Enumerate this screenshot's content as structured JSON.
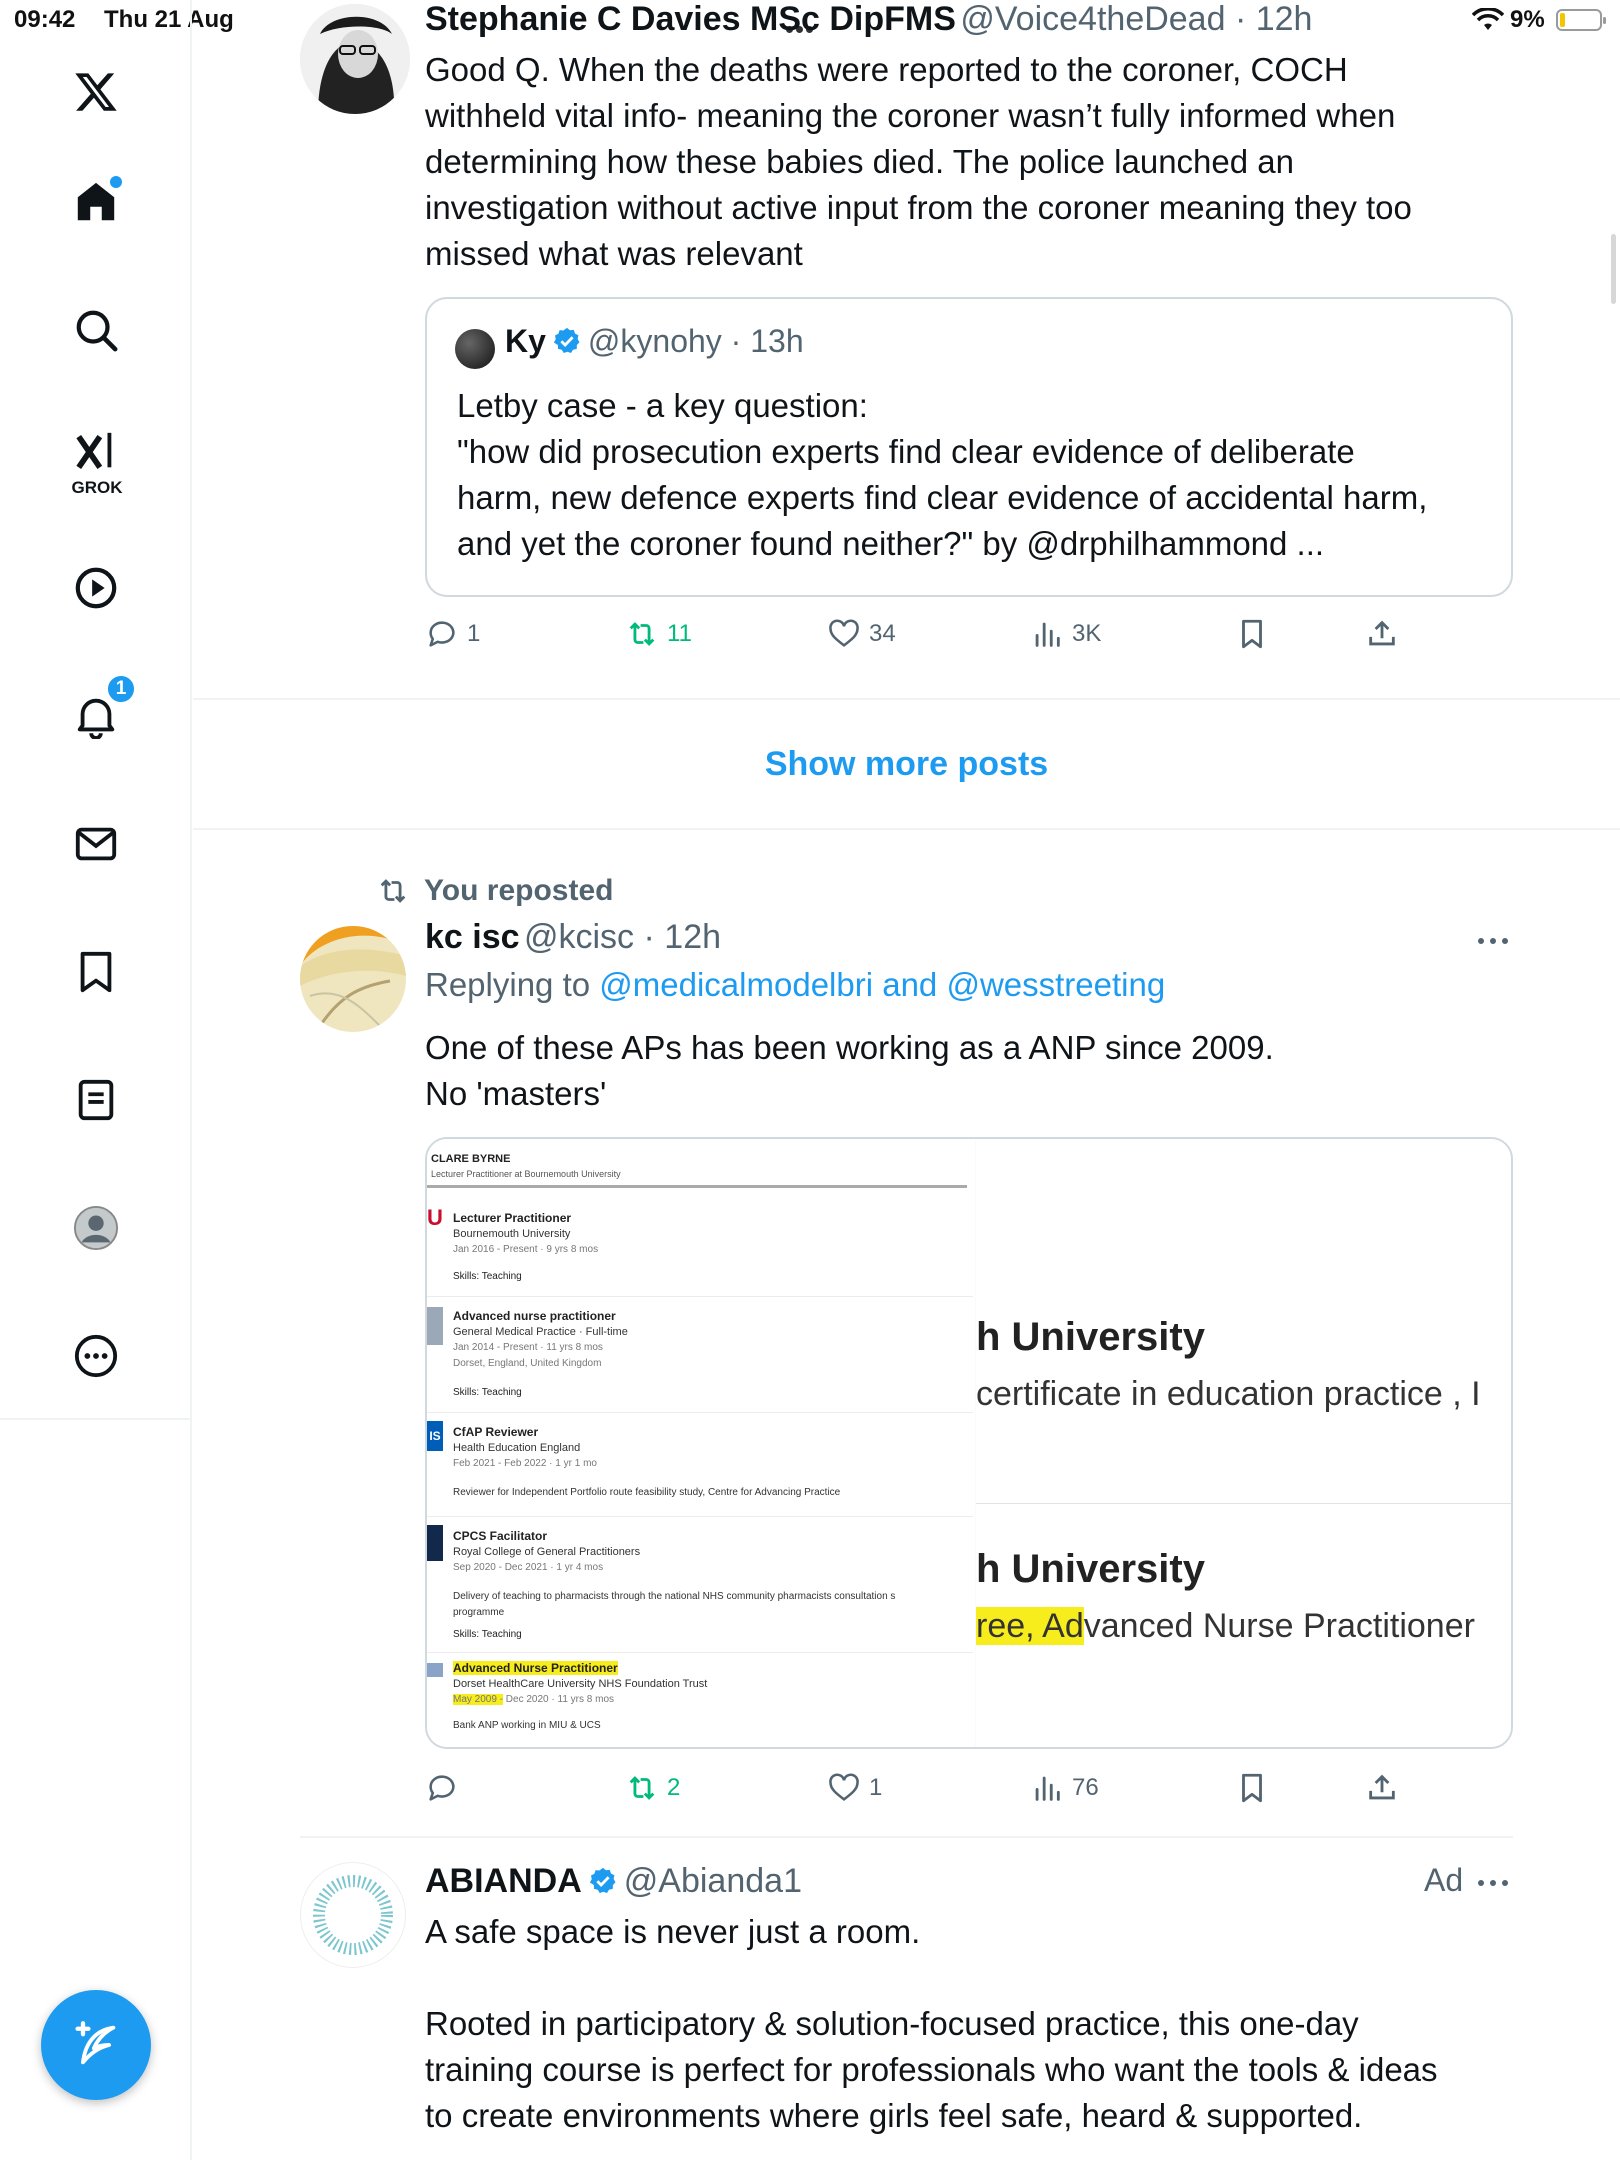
{
  "status_bar": {
    "time": "09:42",
    "date": "Thu 21 Aug",
    "battery": "9%"
  },
  "sidebar": {
    "grok_label": "GROK",
    "notifications_badge": "1"
  },
  "post1": {
    "name": "Stephanie C Davies MSc DipFMS",
    "handle": "@Voice4theDead",
    "time": "12h",
    "lines": [
      "Good Q.  When the deaths were reported to the coroner, COCH",
      "withheld vital info- meaning the coroner wasn’t fully informed when",
      "determining how these babies died. The police launched an",
      "investigation without active input from the coroner meaning they too",
      "missed what was relevant"
    ],
    "quote": {
      "name": "Ky",
      "handle": "@kynohy",
      "time": "13h",
      "lines": [
        "Letby case - a key question:",
        "\"how did prosecution experts find clear evidence of deliberate",
        "harm, new defence experts find clear evidence of accidental harm,",
        "and yet the coroner found neither?\" by @drphilhammond  ..."
      ]
    },
    "actions": {
      "replies": "1",
      "reposts": "11",
      "likes": "34",
      "views": "3K"
    }
  },
  "show_more": "Show more posts",
  "post2": {
    "repost_label": "You reposted",
    "name": "kc isc",
    "handle": "@kcisc",
    "time": "12h",
    "replying_prefix": "Replying to",
    "replying_to": "@medicalmodelbri and @wesstreeting",
    "lines": [
      "One of these APs has been working as a ANP since 2009.",
      "No 'masters'"
    ],
    "actions": {
      "reposts": "2",
      "likes": "1",
      "views": "76"
    },
    "image": {
      "profile_name": "CLARE BYRNE",
      "profile_headline": "Lecturer Practitioner at Bournemouth University",
      "entries": [
        {
          "title": "Lecturer Practitioner",
          "org": "Bournemouth University",
          "dates": "Jan 2016 - Present · 9 yrs 8 mos",
          "extra": "",
          "skills": "Skills: Teaching"
        },
        {
          "title": "Advanced nurse practitioner",
          "org": "General Medical Practice · Full-time",
          "dates": "Jan 2014 - Present · 11 yrs 8 mos",
          "extra": "Dorset, England, United Kingdom",
          "skills": "Skills: Teaching"
        },
        {
          "title": "CfAP Reviewer",
          "org": "Health Education England",
          "dates": "Feb 2021 - Feb 2022 · 1 yr 1 mo",
          "extra": "Reviewer for Independent Portfolio route feasibility study, Centre for Advancing Practice",
          "skills": ""
        },
        {
          "title": "CPCS Facilitator",
          "org": "Royal College of General Practitioners",
          "dates": "Sep 2020 - Dec 2021 · 1 yr 4 mos",
          "extra": "Delivery of teaching to pharmacists through the national NHS community pharmacists consultation s",
          "extra2": "programme",
          "skills": "Skills: Teaching"
        },
        {
          "title": "Advanced Nurse Practitioner",
          "org": "Dorset HealthCare University NHS Foundation Trust",
          "dates_hl": "May 2009 -",
          "dates": " Dec 2020 · 11 yrs 8 mos",
          "extra": "Bank ANP working in MIU & UCS",
          "skills": ""
        }
      ],
      "right": {
        "uni1": "h University",
        "sub1": "certificate in education practice , I",
        "uni2": "h University",
        "sub2_hl": "ree, Ad",
        "sub2": "vanced Nurse Practitioner"
      }
    }
  },
  "post3": {
    "name": "ABIANDA",
    "handle": "@Abianda1",
    "ad_label": "Ad",
    "line1": "A safe space is never just a room.",
    "lines": [
      "Rooted in participatory & solution-focused practice, this one-day",
      "training course is perfect for professionals who want the tools & ideas",
      "to create environments where girls feel safe, heard & supported."
    ]
  },
  "colors": {
    "accent": "#1d9bf0",
    "repost_green": "#00ba7c",
    "secondary_text": "#536471",
    "highlight": "#f7ec1c"
  }
}
